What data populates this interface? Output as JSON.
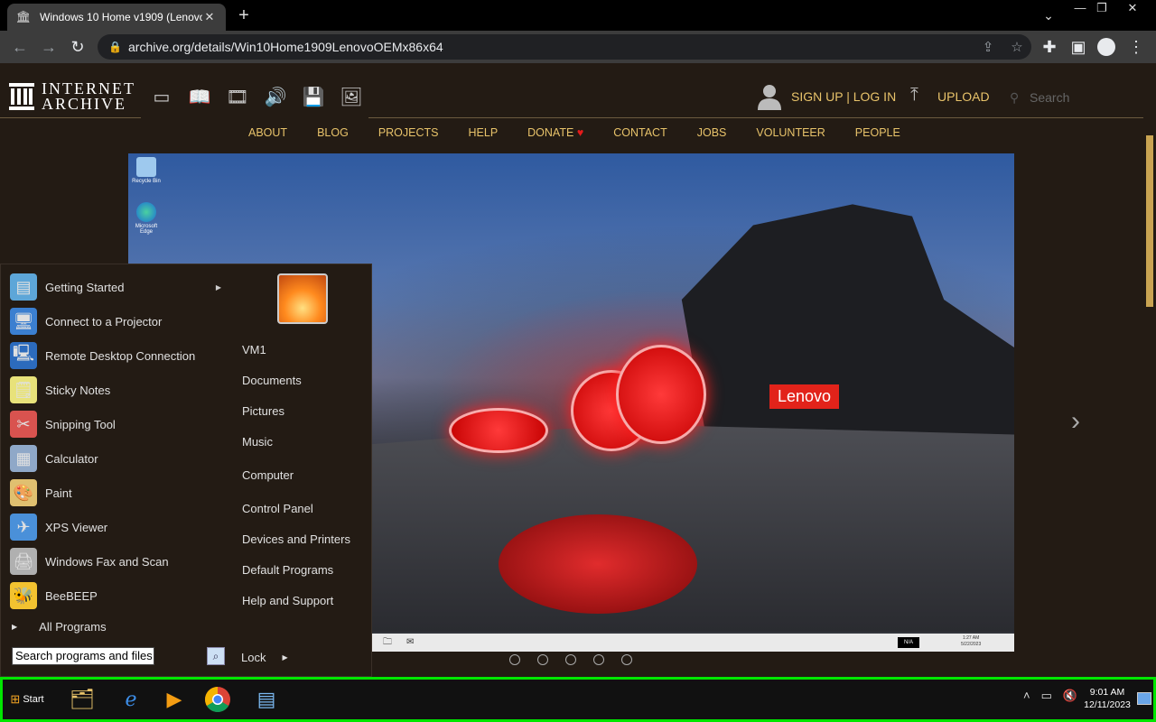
{
  "browser": {
    "tab_title": "Windows 10 Home v1909 (Lenovo",
    "url": "archive.org/details/Win10Home1909LenovoOEMx86x64"
  },
  "ia": {
    "logo_line1": "INTERNET",
    "logo_line2": "ARCHIVE",
    "signup": "SIGN UP | LOG IN",
    "upload": "UPLOAD",
    "search_placeholder": "Search",
    "nav": [
      "ABOUT",
      "BLOG",
      "PROJECTS",
      "HELP",
      "DONATE",
      "CONTACT",
      "JOBS",
      "VOLUNTEER",
      "PEOPLE"
    ]
  },
  "emulator": {
    "desktop_icons": [
      "Recycle Bin",
      "Microsoft Edge"
    ],
    "brand": "Lenovo",
    "na_badge": "N/A",
    "inner_time": "1:27 AM",
    "inner_date": "5/22/2023"
  },
  "start_menu": {
    "programs": [
      {
        "label": "Getting Started",
        "icon": "getting-started-icon"
      },
      {
        "label": "Connect to a Projector",
        "icon": "projector-icon"
      },
      {
        "label": "Remote Desktop Connection",
        "icon": "remote-desktop-icon"
      },
      {
        "label": "Sticky Notes",
        "icon": "sticky-notes-icon"
      },
      {
        "label": "Snipping Tool",
        "icon": "snipping-tool-icon"
      },
      {
        "label": "Calculator",
        "icon": "calculator-icon"
      },
      {
        "label": "Paint",
        "icon": "paint-icon"
      },
      {
        "label": "XPS Viewer",
        "icon": "xps-viewer-icon"
      },
      {
        "label": "Windows Fax and Scan",
        "icon": "fax-scan-icon"
      },
      {
        "label": "BeeBEEP",
        "icon": "beebeep-icon"
      }
    ],
    "all_programs": "All Programs",
    "search_placeholder": "Search programs and files",
    "right_links": [
      "VM1",
      "Documents",
      "Pictures",
      "Music",
      "Computer",
      "Control Panel",
      "Devices and Printers",
      "Default Programs",
      "Help and Support"
    ],
    "lock": "Lock"
  },
  "taskbar": {
    "start": "Start",
    "time": "9:01 AM",
    "date": "12/11/2023"
  },
  "colors": {
    "ia_gold": "#e8c36a",
    "taskbar_border": "#00e600"
  }
}
